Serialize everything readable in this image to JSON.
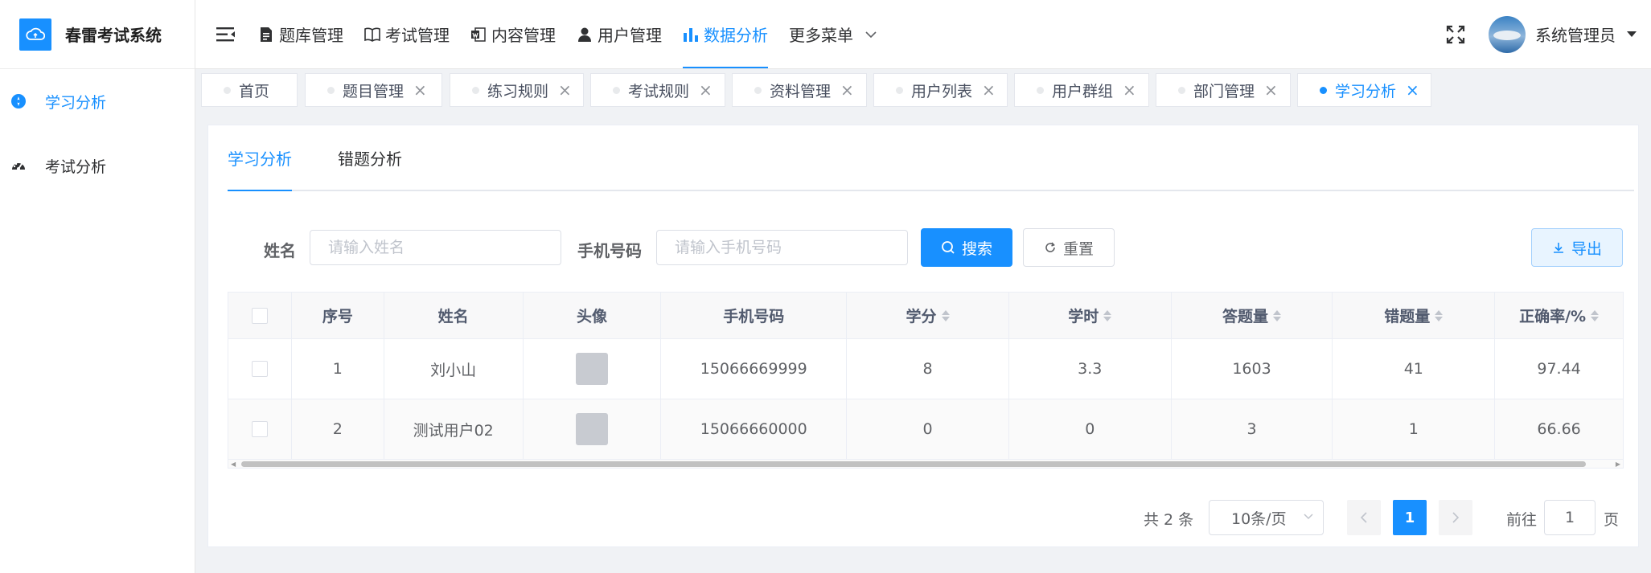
{
  "app": {
    "title": "春雷考试系统"
  },
  "sidebar": {
    "items": [
      {
        "label": "学习分析",
        "icon": "compass-icon",
        "active": true
      },
      {
        "label": "考试分析",
        "icon": "dashboard-icon",
        "active": false
      }
    ]
  },
  "header": {
    "nav": [
      {
        "label": "题库管理",
        "icon": "document-icon"
      },
      {
        "label": "考试管理",
        "icon": "book-icon"
      },
      {
        "label": "内容管理",
        "icon": "word-icon"
      },
      {
        "label": "用户管理",
        "icon": "user-icon"
      },
      {
        "label": "数据分析",
        "icon": "bar-chart-icon",
        "active": true
      },
      {
        "label": "更多菜单",
        "icon": "chevron-down-icon"
      }
    ],
    "user_name": "系统管理员"
  },
  "tags": [
    {
      "label": "首页",
      "closable": false
    },
    {
      "label": "题目管理",
      "closable": true
    },
    {
      "label": "练习规则",
      "closable": true
    },
    {
      "label": "考试规则",
      "closable": true
    },
    {
      "label": "资料管理",
      "closable": true
    },
    {
      "label": "用户列表",
      "closable": true
    },
    {
      "label": "用户群组",
      "closable": true
    },
    {
      "label": "部门管理",
      "closable": true
    },
    {
      "label": "学习分析",
      "closable": true,
      "active": true
    }
  ],
  "tabs": [
    {
      "label": "学习分析",
      "active": true
    },
    {
      "label": "错题分析",
      "active": false
    }
  ],
  "search": {
    "name_label": "姓名",
    "name_placeholder": "请输入姓名",
    "name_value": "",
    "phone_label": "手机号码",
    "phone_placeholder": "请输入手机号码",
    "phone_value": "",
    "search_label": "搜索",
    "reset_label": "重置",
    "export_label": "导出"
  },
  "table": {
    "columns": [
      "序号",
      "姓名",
      "头像",
      "手机号码",
      "学分",
      "学时",
      "答题量",
      "错题量",
      "正确率/%"
    ],
    "rows": [
      [
        "1",
        "刘小山",
        "",
        "15066669999",
        "8",
        "3.3",
        "1603",
        "41",
        "97.44"
      ],
      [
        "2",
        "测试用户02",
        "",
        "15066660000",
        "0",
        "0",
        "3",
        "1",
        "66.66"
      ]
    ]
  },
  "pagination": {
    "total_text": "共 2 条",
    "page_size": "10条/页",
    "current_page": "1",
    "goto_label": "前往",
    "goto_value": "1",
    "page_suffix": "页"
  },
  "colors": {
    "accent": "#1890ff",
    "text": "#303133",
    "muted": "#606266",
    "border": "#ebeef5"
  }
}
